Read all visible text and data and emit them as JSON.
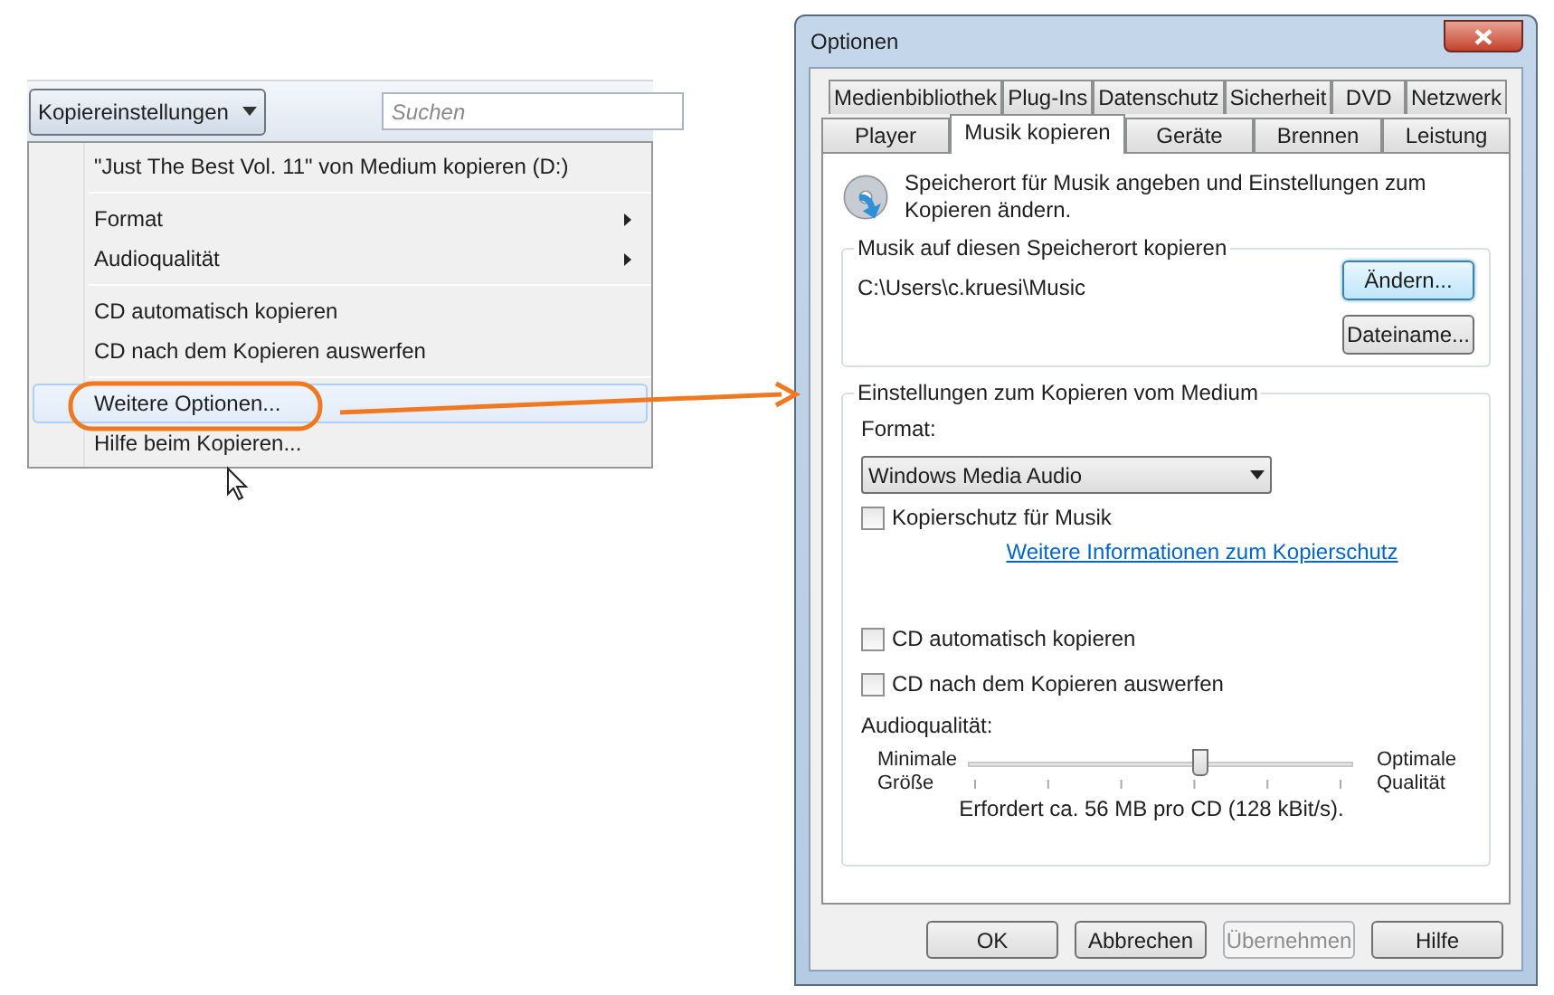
{
  "toolbar": {
    "copy_settings_button": "Kopiereinstellungen",
    "search": {
      "placeholder": "Suchen"
    }
  },
  "menu": {
    "groups": [
      [
        {
          "label": "\"Just The Best Vol. 11\" von Medium kopieren (D:)",
          "kind": "item",
          "selected": false
        }
      ],
      [
        {
          "label": "Format",
          "kind": "submenu",
          "selected": false
        },
        {
          "label": "Audioqualität",
          "kind": "submenu",
          "selected": false
        }
      ],
      [
        {
          "label": "CD automatisch kopieren",
          "kind": "item",
          "selected": false
        },
        {
          "label": "CD nach dem Kopieren auswerfen",
          "kind": "item",
          "selected": false
        }
      ],
      [
        {
          "label": "Weitere Optionen...",
          "kind": "item",
          "selected": true
        },
        {
          "label": "Hilfe beim Kopieren...",
          "kind": "item",
          "selected": false
        }
      ]
    ]
  },
  "dialog": {
    "title": "Optionen",
    "tab_rows": [
      [
        {
          "label": "Medienbibliothek",
          "selected": false
        },
        {
          "label": "Plug-Ins",
          "selected": false
        },
        {
          "label": "Datenschutz",
          "selected": false
        },
        {
          "label": "Sicherheit",
          "selected": false
        },
        {
          "label": "DVD",
          "selected": false
        },
        {
          "label": "Netzwerk",
          "selected": false
        }
      ],
      [
        {
          "label": "Player",
          "selected": false
        },
        {
          "label": "Musik kopieren",
          "selected": true
        },
        {
          "label": "Geräte",
          "selected": false
        },
        {
          "label": "Brennen",
          "selected": false
        },
        {
          "label": "Leistung",
          "selected": false
        }
      ]
    ],
    "description": "Speicherort für Musik angeben und Einstellungen zum Kopieren ändern.",
    "location_group": {
      "title": "Musik auf diesen Speicherort kopieren",
      "path": "C:\\Users\\c.kruesi\\Music",
      "buttons": [
        {
          "label": "Ändern...",
          "focused": true
        },
        {
          "label": "Dateiname...",
          "focused": false
        }
      ]
    },
    "settings_group": {
      "title": "Einstellungen zum Kopieren vom Medium",
      "format_label": "Format:",
      "format_value": "Windows Media Audio",
      "copy_protection": {
        "label": "Kopierschutz für Musik",
        "checked": false
      },
      "info_link": "Weitere Informationen zum Kopierschutz",
      "checkboxes": [
        {
          "label": "CD automatisch kopieren",
          "checked": false
        },
        {
          "label": "CD nach dem Kopieren auswerfen",
          "checked": false
        }
      ],
      "quality_label": "Audioqualität:",
      "quality_slider": {
        "min_label": "Minimale Größe",
        "max_label": "Optimale Qualität",
        "level": 0.6
      },
      "requirement": "Erfordert ca. 56 MB pro CD (128 kBit/s)."
    },
    "buttons": [
      {
        "label": "OK",
        "disabled": false
      },
      {
        "label": "Abbrechen",
        "disabled": false
      },
      {
        "label": "Übernehmen",
        "disabled": true
      },
      {
        "label": "Hilfe",
        "disabled": false
      }
    ]
  }
}
